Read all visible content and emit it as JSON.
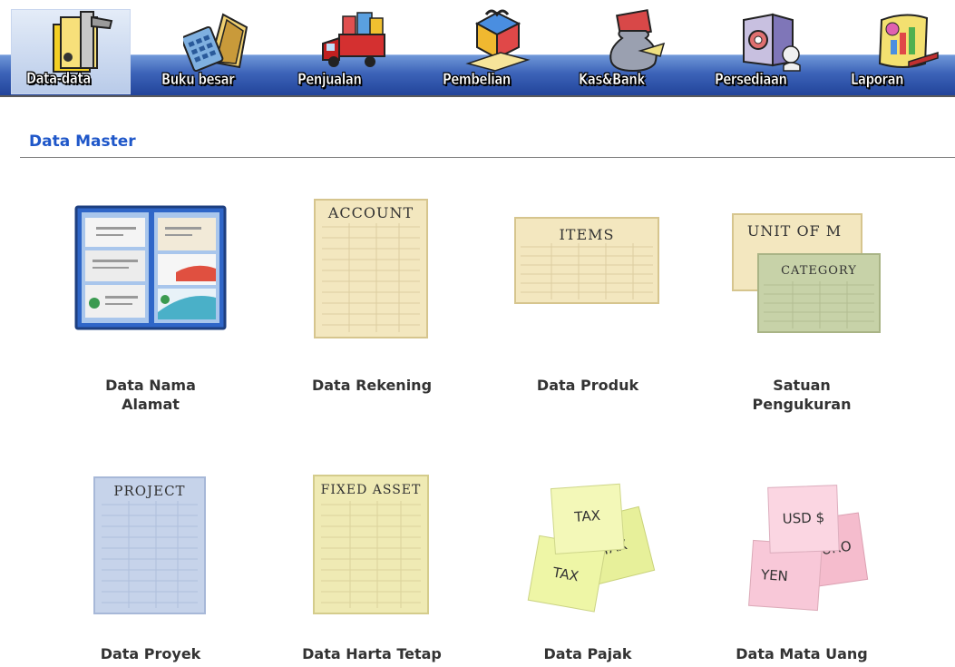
{
  "toolbar": {
    "items": [
      {
        "label": "Data-data",
        "icon": "folders-icon",
        "active": true
      },
      {
        "label": "Buku besar",
        "icon": "ledger-calculator-icon",
        "active": false
      },
      {
        "label": "Penjualan",
        "icon": "delivery-truck-icon",
        "active": false
      },
      {
        "label": "Pembelian",
        "icon": "gift-package-icon",
        "active": false
      },
      {
        "label": "Kas&Bank",
        "icon": "money-bag-icon",
        "active": false
      },
      {
        "label": "Persediaan",
        "icon": "warehouse-safe-icon",
        "active": false
      },
      {
        "label": "Laporan",
        "icon": "report-chart-icon",
        "active": false
      }
    ]
  },
  "section": {
    "title": "Data Master"
  },
  "tiles": [
    {
      "label": "Data Nama Alamat",
      "line1": "Data Nama",
      "line2": "Alamat",
      "icon": "business-card-holder-icon"
    },
    {
      "label": "Data Rekening",
      "icon": "account-sheet-icon",
      "sheet_title": "ACCOUNT"
    },
    {
      "label": "Data Produk",
      "icon": "items-sheet-icon",
      "sheet_title": "ITEMS"
    },
    {
      "label": "Satuan Pengukuran",
      "line1": "Satuan",
      "line2": "Pengukuran",
      "icon": "unit-category-sheets-icon",
      "sheet_title": "UNIT OF M",
      "sheet_title_2": "CATEGORY"
    },
    {
      "label": "Data Proyek",
      "icon": "project-sheet-icon",
      "sheet_title": "PROJECT"
    },
    {
      "label": "Data Harta Tetap",
      "icon": "fixed-asset-sheet-icon",
      "sheet_title": "FIXED ASSET"
    },
    {
      "label": "Data Pajak",
      "icon": "tax-sticky-notes-icon",
      "notes": [
        "TAX",
        "TAX",
        "TAX"
      ]
    },
    {
      "label": "Data Mata Uang",
      "icon": "currency-sticky-notes-icon",
      "notes": [
        "USD $",
        "EURO",
        "YEN"
      ]
    }
  ],
  "colors": {
    "toolbar_band": "#3c63b8",
    "section_title": "#1f57c9",
    "sheet_cream": "#f3e7bf",
    "sheet_blue": "#c6d3ea",
    "sheet_green": "#c7d2a8",
    "note_yellow": "#eef6a6",
    "note_pink": "#f8c8d8"
  }
}
